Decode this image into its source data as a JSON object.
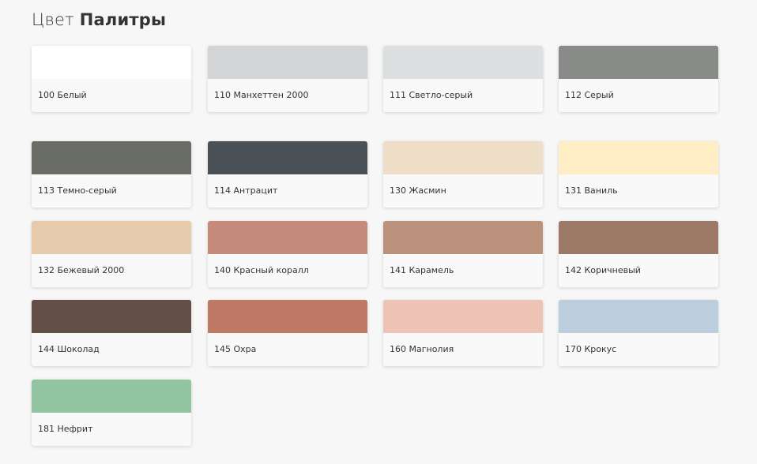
{
  "header": {
    "title_light": "Цвет",
    "title_bold": "Палитры"
  },
  "colors": [
    {
      "label": "100 Белый",
      "hex": "#ffffff"
    },
    {
      "label": "110 Манхеттен 2000",
      "hex": "#d3d4d6"
    },
    {
      "label": "111 Светло-серый",
      "hex": "#dde0e1"
    },
    {
      "label": "112 Серый",
      "hex": "#898b89"
    },
    {
      "label": "113 Темно-серый",
      "hex": "#6a6d65"
    },
    {
      "label": "114 Антрацит",
      "hex": "#495056"
    },
    {
      "label": "130 Жасмин",
      "hex": "#efdec7"
    },
    {
      "label": "131 Ваниль",
      "hex": "#ffedc6"
    },
    {
      "label": "132 Бежевый 2000",
      "hex": "#e5cbab"
    },
    {
      "label": "140 Красный коралл",
      "hex": "#c48b7b"
    },
    {
      "label": "141 Карамель",
      "hex": "#bb937c"
    },
    {
      "label": "142 Коричневый",
      "hex": "#9b7966"
    },
    {
      "label": "144 Шоколад",
      "hex": "#634f47"
    },
    {
      "label": "145 Охра",
      "hex": "#bf7967"
    },
    {
      "label": "160 Магнолия",
      "hex": "#ecc3b5"
    },
    {
      "label": "170 Крокус",
      "hex": "#bccede"
    },
    {
      "label": "181 Нефрит",
      "hex": "#93c4a2"
    }
  ]
}
